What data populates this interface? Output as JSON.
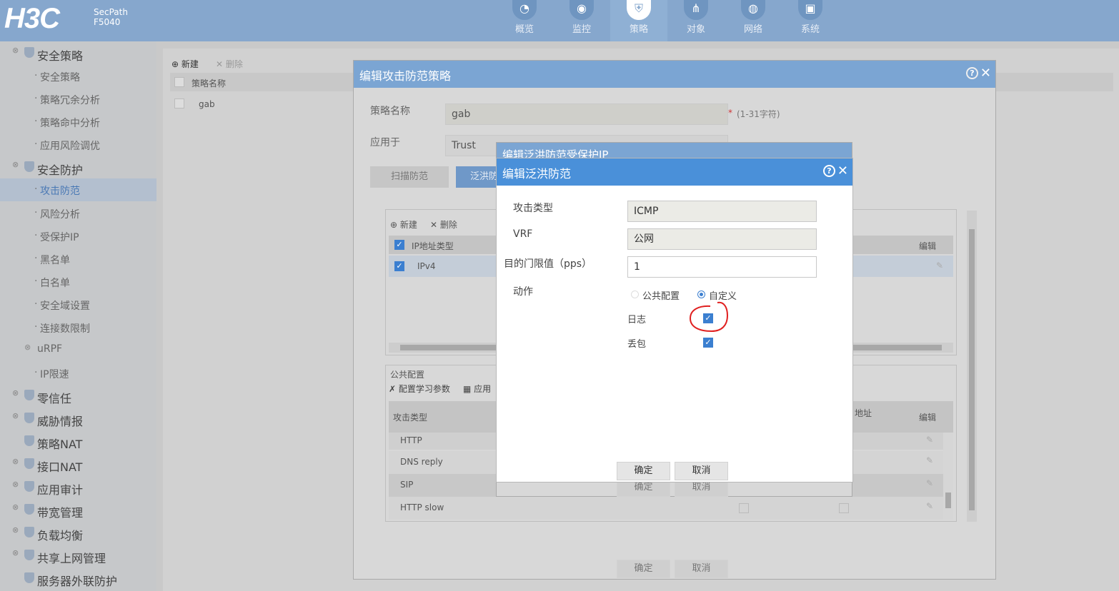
{
  "brand": {
    "logo": "H3C",
    "product": "SecPath",
    "model": "F5040"
  },
  "nav": [
    {
      "label": "概览",
      "icon": "dashboard-icon"
    },
    {
      "label": "监控",
      "icon": "monitor-icon"
    },
    {
      "label": "策略",
      "icon": "shield-icon",
      "active": true
    },
    {
      "label": "对象",
      "icon": "share-icon"
    },
    {
      "label": "网络",
      "icon": "globe-icon"
    },
    {
      "label": "系统",
      "icon": "system-icon"
    }
  ],
  "sidebar": {
    "groups": [
      {
        "label": "安全策略",
        "items": [
          "安全策略",
          "策略冗余分析",
          "策略命中分析",
          "应用风险调优"
        ]
      },
      {
        "label": "安全防护",
        "items": [
          "攻击防范",
          "风险分析",
          "受保护IP",
          "黑名单",
          "白名单",
          "安全域设置",
          "连接数限制"
        ]
      },
      {
        "label": "uRPF",
        "items": [
          "IP限速"
        ]
      },
      {
        "label": "零信任"
      },
      {
        "label": "威胁情报"
      },
      {
        "label": "策略NAT"
      },
      {
        "label": "接口NAT"
      },
      {
        "label": "应用审计"
      },
      {
        "label": "带宽管理"
      },
      {
        "label": "负载均衡"
      },
      {
        "label": "共享上网管理"
      },
      {
        "label": "服务器外联防护"
      }
    ],
    "active_item": "攻击防范"
  },
  "list": {
    "new": "新建",
    "delete": "删除",
    "col_name": "策略名称",
    "row": "gab"
  },
  "outer": {
    "title": "编辑攻击防范策略",
    "name_label": "策略名称",
    "name_value": "gab",
    "name_hint": "(1-31字符)",
    "apply_label": "应用于",
    "apply_value": "Trust",
    "tab_scan": "扫描防范",
    "tab_flood": "泛洪防",
    "protected": {
      "new": "新建",
      "delete": "删除",
      "col_type": "IP地址类型",
      "col_edit": "编辑",
      "row_type": "IPv4"
    },
    "public": {
      "title": "公共配置",
      "learn": "配置学习参数",
      "apply": "应用",
      "col_attack": "攻击类型",
      "col_addr": "地址",
      "col_edit": "编辑",
      "rows": [
        "HTTP",
        "DNS reply",
        "SIP",
        "HTTP slow"
      ]
    },
    "ok": "确定",
    "cancel": "取消"
  },
  "middle": {
    "title": "编辑泛洪防范受保护IP",
    "ok": "确定",
    "cancel": "取消"
  },
  "inner": {
    "title": "编辑泛洪防范",
    "fields": {
      "attack_type_label": "攻击类型",
      "attack_type_value": "ICMP",
      "vrf_label": "VRF",
      "vrf_value": "公网",
      "threshold_label": "目的门限值（pps）",
      "threshold_value": "1",
      "action_label": "动作"
    },
    "action": {
      "public": "公共配置",
      "custom": "自定义",
      "selected": "custom"
    },
    "log_label": "日志",
    "drop_label": "丢包",
    "log_checked": true,
    "drop_checked": true,
    "ok": "确定",
    "cancel": "取消"
  }
}
